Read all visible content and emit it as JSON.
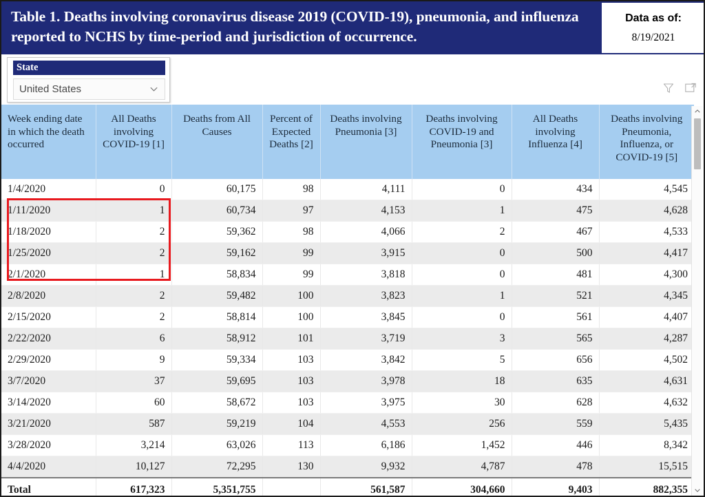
{
  "banner": {
    "title": "Table 1. Deaths involving coronavirus disease 2019 (COVID-19), pneumonia, and influenza reported to NCHS by time-period and jurisdiction of occurrence.",
    "data_as_of_label": "Data as of:",
    "data_as_of_value": "8/19/2021",
    "accent_color": "#1f2a78"
  },
  "slicer": {
    "header_label": "State",
    "selected_value": "United States",
    "chevron_icon": "chevron-down-icon"
  },
  "viz_header_icons": [
    {
      "name": "filter-icon",
      "title": "Filters"
    },
    {
      "name": "focus-mode-icon",
      "title": "Focus mode"
    }
  ],
  "table": {
    "header_bg": "#a5cdf0",
    "columns": [
      {
        "key": "week",
        "label": "Week ending date in which the death occurred",
        "align": "left",
        "sorted": true,
        "sort_dir": "asc"
      },
      {
        "key": "covid",
        "label": "All Deaths involving COVID-19 [1]",
        "align": "right",
        "sorted": false
      },
      {
        "key": "allcause",
        "label": "Deaths from All Causes",
        "align": "right",
        "sorted": false
      },
      {
        "key": "pctexp",
        "label": "Percent of Expected Deaths [2]",
        "align": "right",
        "sorted": false
      },
      {
        "key": "pneu",
        "label": "Deaths involving Pneumonia [3]",
        "align": "right",
        "sorted": false
      },
      {
        "key": "covidpneu",
        "label": "Deaths involving COVID-19 and Pneumonia [3]",
        "align": "right",
        "sorted": false
      },
      {
        "key": "flu",
        "label": "All Deaths involving Influenza [4]",
        "align": "right",
        "sorted": false
      },
      {
        "key": "combined",
        "label": "Deaths involving Pneumonia, Influenza, or COVID-19 [5]",
        "align": "right",
        "sorted": false
      }
    ],
    "rows": [
      {
        "week": "1/4/2020",
        "covid": "0",
        "allcause": "60,175",
        "pctexp": "98",
        "pneu": "4,111",
        "covidpneu": "0",
        "flu": "434",
        "combined": "4,545"
      },
      {
        "week": "1/11/2020",
        "covid": "1",
        "allcause": "60,734",
        "pctexp": "97",
        "pneu": "4,153",
        "covidpneu": "1",
        "flu": "475",
        "combined": "4,628"
      },
      {
        "week": "1/18/2020",
        "covid": "2",
        "allcause": "59,362",
        "pctexp": "98",
        "pneu": "4,066",
        "covidpneu": "2",
        "flu": "467",
        "combined": "4,533"
      },
      {
        "week": "1/25/2020",
        "covid": "2",
        "allcause": "59,162",
        "pctexp": "99",
        "pneu": "3,915",
        "covidpneu": "0",
        "flu": "500",
        "combined": "4,417"
      },
      {
        "week": "2/1/2020",
        "covid": "1",
        "allcause": "58,834",
        "pctexp": "99",
        "pneu": "3,818",
        "covidpneu": "0",
        "flu": "481",
        "combined": "4,300"
      },
      {
        "week": "2/8/2020",
        "covid": "2",
        "allcause": "59,482",
        "pctexp": "100",
        "pneu": "3,823",
        "covidpneu": "1",
        "flu": "521",
        "combined": "4,345"
      },
      {
        "week": "2/15/2020",
        "covid": "2",
        "allcause": "58,814",
        "pctexp": "100",
        "pneu": "3,845",
        "covidpneu": "0",
        "flu": "561",
        "combined": "4,407"
      },
      {
        "week": "2/22/2020",
        "covid": "6",
        "allcause": "58,912",
        "pctexp": "101",
        "pneu": "3,719",
        "covidpneu": "3",
        "flu": "565",
        "combined": "4,287"
      },
      {
        "week": "2/29/2020",
        "covid": "9",
        "allcause": "59,334",
        "pctexp": "103",
        "pneu": "3,842",
        "covidpneu": "5",
        "flu": "656",
        "combined": "4,502"
      },
      {
        "week": "3/7/2020",
        "covid": "37",
        "allcause": "59,695",
        "pctexp": "103",
        "pneu": "3,978",
        "covidpneu": "18",
        "flu": "635",
        "combined": "4,631"
      },
      {
        "week": "3/14/2020",
        "covid": "60",
        "allcause": "58,672",
        "pctexp": "103",
        "pneu": "3,975",
        "covidpneu": "30",
        "flu": "628",
        "combined": "4,632"
      },
      {
        "week": "3/21/2020",
        "covid": "587",
        "allcause": "59,219",
        "pctexp": "104",
        "pneu": "4,553",
        "covidpneu": "256",
        "flu": "559",
        "combined": "5,435"
      },
      {
        "week": "3/28/2020",
        "covid": "3,214",
        "allcause": "63,026",
        "pctexp": "113",
        "pneu": "6,186",
        "covidpneu": "1,452",
        "flu": "446",
        "combined": "8,342"
      },
      {
        "week": "4/4/2020",
        "covid": "10,127",
        "allcause": "72,295",
        "pctexp": "130",
        "pneu": "9,932",
        "covidpneu": "4,787",
        "flu": "478",
        "combined": "15,515"
      }
    ],
    "total_row": {
      "week": "Total",
      "covid": "617,323",
      "allcause": "5,351,755",
      "pctexp": "",
      "pneu": "561,587",
      "covidpneu": "304,660",
      "flu": "9,403",
      "combined": "882,355"
    }
  },
  "annotation": {
    "highlight_color": "#e8191e",
    "highlight_description": "Red rectangle around week ending dates 1/11/2020 through 2/1/2020 and their COVID-19 death counts"
  },
  "scrollbar": {
    "up_arrow_icon": "chevron-up-icon",
    "down_arrow_icon": "chevron-down-icon",
    "thumb": "scroll-thumb"
  }
}
